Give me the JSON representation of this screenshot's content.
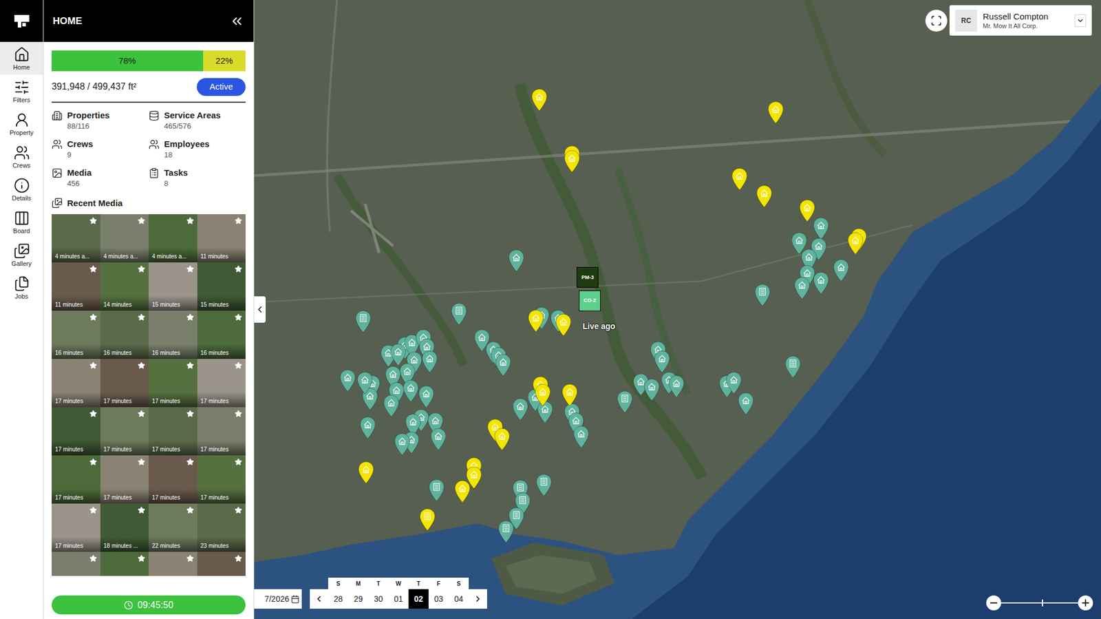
{
  "header": {
    "title": "HOME"
  },
  "nav": [
    {
      "label": "Home",
      "selected": true
    },
    {
      "label": "Filters",
      "selected": false
    },
    {
      "label": "Property",
      "selected": false
    },
    {
      "label": "Crews",
      "selected": false
    },
    {
      "label": "Details",
      "selected": false
    },
    {
      "label": "Board",
      "selected": false
    },
    {
      "label": "Gallery",
      "selected": false
    },
    {
      "label": "Jobs",
      "selected": false
    }
  ],
  "progress": {
    "level": 0.78,
    "done_label": "78%",
    "rest_label": "22%"
  },
  "area": {
    "text": "391,948 / 499,437 ft²",
    "status": "Active"
  },
  "stats": [
    {
      "label": "Properties",
      "value": "88/116"
    },
    {
      "label": "Service Areas",
      "value": "465/576"
    },
    {
      "label": "Crews",
      "value": "9"
    },
    {
      "label": "Employees",
      "value": "18"
    },
    {
      "label": "Media",
      "value": "456"
    },
    {
      "label": "Tasks",
      "value": "8"
    }
  ],
  "recent_media": {
    "title": "Recent Media",
    "items": [
      {
        "caption": "4 minutes a..."
      },
      {
        "caption": "4 minutes a..."
      },
      {
        "caption": "4 minutes a..."
      },
      {
        "caption": "11 minutes"
      },
      {
        "caption": "11 minutes"
      },
      {
        "caption": "14 minutes"
      },
      {
        "caption": "15 minutes"
      },
      {
        "caption": "15 minutes"
      },
      {
        "caption": "16 minutes"
      },
      {
        "caption": "16 minutes"
      },
      {
        "caption": "16 minutes"
      },
      {
        "caption": "16 minutes"
      },
      {
        "caption": "17 minutes"
      },
      {
        "caption": "17 minutes"
      },
      {
        "caption": "17 minutes"
      },
      {
        "caption": "17 minutes"
      },
      {
        "caption": "17 minutes"
      },
      {
        "caption": "17 minutes"
      },
      {
        "caption": "17 minutes"
      },
      {
        "caption": "17 minutes"
      },
      {
        "caption": "17 minutes"
      },
      {
        "caption": "17 minutes"
      },
      {
        "caption": "17 minutes"
      },
      {
        "caption": "17 minutes"
      },
      {
        "caption": "17 minutes"
      },
      {
        "caption": "18 minutes ..."
      },
      {
        "caption": "22 minutes"
      },
      {
        "caption": "23 minutes"
      },
      {
        "caption": ""
      },
      {
        "caption": ""
      },
      {
        "caption": ""
      },
      {
        "caption": ""
      }
    ]
  },
  "timer": "09:45:50",
  "user": {
    "initials": "RC",
    "name": "Russell Compton",
    "company": "Mr. Mow It All Corp."
  },
  "date_field": "7/2026",
  "week": [
    {
      "letter": "S",
      "date": "28",
      "selected": false
    },
    {
      "letter": "M",
      "date": "29",
      "selected": false
    },
    {
      "letter": "T",
      "date": "30",
      "selected": false
    },
    {
      "letter": "W",
      "date": "01",
      "selected": false
    },
    {
      "letter": "T",
      "date": "02",
      "selected": true
    },
    {
      "letter": "F",
      "date": "03",
      "selected": false
    },
    {
      "letter": "S",
      "date": "04",
      "selected": false
    }
  ],
  "zoom": {
    "level": 0.53
  },
  "crew_markers": [
    {
      "label": "PM-3",
      "color": "#1e3b10"
    },
    {
      "label": "CO-2",
      "color": "#5fcf8c"
    }
  ],
  "live_label": "Live ago",
  "pins": [
    {
      "color": "#5fb39d",
      "kind": "house"
    },
    {
      "color": "#5fb39d",
      "kind": "doc"
    },
    {
      "color": "#5fb39d",
      "kind": "doc"
    },
    {
      "color": "#5fb39d",
      "kind": "house"
    },
    {
      "color": "#5fb39d",
      "kind": "house"
    },
    {
      "color": "#5fb39d",
      "kind": "house"
    },
    {
      "color": "#5fb39d",
      "kind": "house"
    },
    {
      "color": "#5fb39d",
      "kind": "house"
    },
    {
      "color": "#5fb39d",
      "kind": "house"
    },
    {
      "color": "#5fb39d",
      "kind": "house"
    },
    {
      "color": "#5fb39d",
      "kind": "house"
    },
    {
      "color": "#5fb39d",
      "kind": "doc"
    },
    {
      "color": "#5fb39d",
      "kind": "house"
    },
    {
      "color": "#5fb39d",
      "kind": "house"
    },
    {
      "color": "#5fb39d",
      "kind": "house"
    },
    {
      "color": "#5fb39d",
      "kind": "house"
    },
    {
      "color": "#5fb39d",
      "kind": "house"
    },
    {
      "color": "#5fb39d",
      "kind": "house"
    },
    {
      "color": "#5fb39d",
      "kind": "house"
    },
    {
      "color": "#5fb39d",
      "kind": "house"
    },
    {
      "color": "#5fb39d",
      "kind": "house"
    },
    {
      "color": "#5fb39d",
      "kind": "house"
    },
    {
      "color": "#5fb39d",
      "kind": "house"
    },
    {
      "color": "#5fb39d",
      "kind": "house"
    },
    {
      "color": "#5fb39d",
      "kind": "house"
    },
    {
      "color": "#5fb39d",
      "kind": "house"
    },
    {
      "color": "#5fb39d",
      "kind": "house"
    },
    {
      "color": "#5fb39d",
      "kind": "house"
    },
    {
      "color": "#5fb39d",
      "kind": "house"
    },
    {
      "color": "#5fb39d",
      "kind": "house"
    },
    {
      "color": "#5fb39d",
      "kind": "house"
    },
    {
      "color": "#5fb39d",
      "kind": "house"
    },
    {
      "color": "#5fb39d",
      "kind": "house"
    },
    {
      "color": "#5fb39d",
      "kind": "house"
    },
    {
      "color": "#5fb39d",
      "kind": "house"
    },
    {
      "color": "#5fb39d",
      "kind": "house"
    },
    {
      "color": "#5fb39d",
      "kind": "house"
    },
    {
      "color": "#5fb39d",
      "kind": "house"
    },
    {
      "color": "#5fb39d",
      "kind": "house"
    },
    {
      "color": "#5fb39d",
      "kind": "house"
    },
    {
      "color": "#5fb39d",
      "kind": "house"
    },
    {
      "color": "#5fb39d",
      "kind": "house"
    },
    {
      "color": "#5fb39d",
      "kind": "house"
    },
    {
      "color": "#5fb39d",
      "kind": "house"
    },
    {
      "color": "#5fb39d",
      "kind": "house"
    },
    {
      "color": "#5fb39d",
      "kind": "house"
    },
    {
      "color": "#5fb39d",
      "kind": "house"
    },
    {
      "color": "#5fb39d",
      "kind": "house"
    },
    {
      "color": "#5fb39d",
      "kind": "house"
    },
    {
      "color": "#5fb39d",
      "kind": "house"
    },
    {
      "color": "#5fb39d",
      "kind": "house"
    },
    {
      "color": "#5fb39d",
      "kind": "house"
    },
    {
      "color": "#5fb39d",
      "kind": "house"
    },
    {
      "color": "#5fb39d",
      "kind": "house"
    },
    {
      "color": "#5fb39d",
      "kind": "doc"
    },
    {
      "color": "#5fb39d",
      "kind": "house"
    },
    {
      "color": "#5fb39d",
      "kind": "house"
    },
    {
      "color": "#5fb39d",
      "kind": "house"
    },
    {
      "color": "#5fb39d",
      "kind": "doc"
    },
    {
      "color": "#5fb39d",
      "kind": "doc"
    },
    {
      "color": "#5fb39d",
      "kind": "doc"
    },
    {
      "color": "#5fb39d",
      "kind": "doc"
    },
    {
      "color": "#5fb39d",
      "kind": "doc"
    },
    {
      "color": "#5fb39d",
      "kind": "doc"
    },
    {
      "color": "#5fb39d",
      "kind": "doc"
    },
    {
      "color": "#5fb39d",
      "kind": "house"
    },
    {
      "color": "#f4e500",
      "kind": "house"
    },
    {
      "color": "#f4e500",
      "kind": "house"
    },
    {
      "color": "#f4e500",
      "kind": "house"
    },
    {
      "color": "#f4e500",
      "kind": "house"
    },
    {
      "color": "#f4e500",
      "kind": "house"
    },
    {
      "color": "#f4e500",
      "kind": "house"
    },
    {
      "color": "#f4e500",
      "kind": "house"
    },
    {
      "color": "#f4e500",
      "kind": "house"
    },
    {
      "color": "#f4e500",
      "kind": "house"
    },
    {
      "color": "#f4e500",
      "kind": "house"
    },
    {
      "color": "#f4e500",
      "kind": "house"
    },
    {
      "color": "#f4e500",
      "kind": "house"
    },
    {
      "color": "#f4e500",
      "kind": "house"
    },
    {
      "color": "#f4e500",
      "kind": "house"
    },
    {
      "color": "#f4e500",
      "kind": "house"
    },
    {
      "color": "#f4e500",
      "kind": "house"
    },
    {
      "color": "#f4e500",
      "kind": "house"
    },
    {
      "color": "#f4e500",
      "kind": "house"
    },
    {
      "color": "#f4e500",
      "kind": "house"
    },
    {
      "color": "#f4e500",
      "kind": "house"
    },
    {
      "color": "#f4e500",
      "kind": "doc"
    }
  ]
}
